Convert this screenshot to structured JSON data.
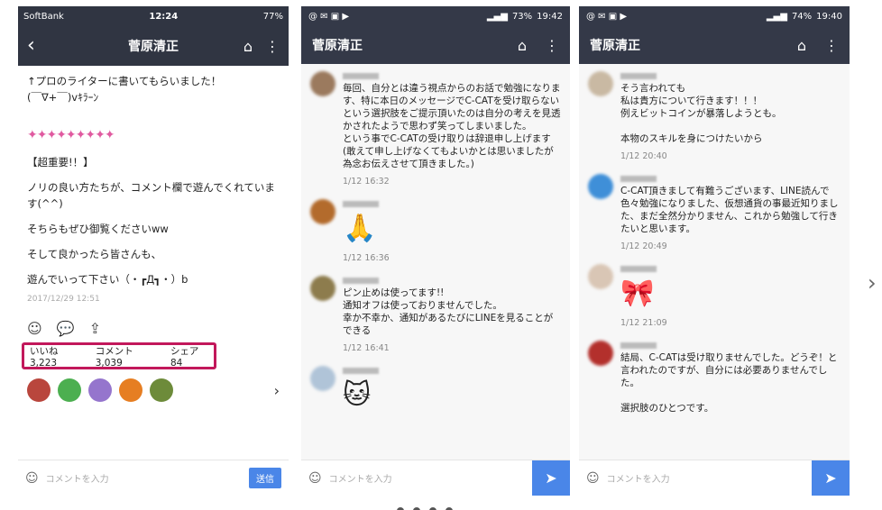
{
  "phone1": {
    "status": {
      "carrier": "SoftBank",
      "time": "12:24",
      "battery": "77%"
    },
    "title": "菅原清正",
    "post": {
      "lines": [
        "↑プロのライターに書いてもらいました！",
        "(￣∇+￣)vｷﾗｰﾝ",
        "【超重要!！】",
        "ノリの良い方たちが、コメント欄で遊んでくれています(^^)",
        "そちらもぜひ御覧くださいww",
        "そして良かったら皆さんも、",
        "遊んでいって下さい（・┏Д┓・）b"
      ],
      "sparkles": "✦✦✦✦✦✦✦✦✦",
      "date": "2017/12/29 12:51"
    },
    "stats": {
      "likes": "いいね 3,223",
      "comments": "コメント 3,039",
      "shares": "シェア 84"
    },
    "input_placeholder": "コメントを入力",
    "send_label": "送信"
  },
  "phone2": {
    "status": {
      "time": "19:42",
      "battery": "73%"
    },
    "title": "菅原清正",
    "comments": [
      {
        "text": "毎回、自分とは違う視点からのお話で勉強になります、特に本日のメッセージでC-CATを受け取らないという選択肢をご提示頂いたのは自分の考えを見透かされたようで思わず笑ってしまいました。\nという事でC-CATの受け取りは辞退申し上げます(敢えて申し上げなくてもよいかとは思いましたが為念お伝えさせて頂きました。)",
        "time": "1/12 16:32"
      },
      {
        "text": "",
        "time": "1/12 16:36"
      },
      {
        "text": "ピン止めは使ってます!!\n通知オフは使っておりませんでした。\n幸か不幸か、通知があるたびにLINEを見ることができる",
        "time": "1/12 16:41"
      },
      {
        "text": "",
        "time": ""
      }
    ],
    "input_placeholder": "コメントを入力"
  },
  "phone3": {
    "status": {
      "time": "19:40",
      "battery": "74%"
    },
    "title": "菅原清正",
    "comments": [
      {
        "text": "そう言われても\n私は貴方について行きます！！！\n例えビットコインが暴落しようとも。\n\n本物のスキルを身につけたいから",
        "time": "1/12 20:40"
      },
      {
        "text": "C-CAT頂きまして有難うございます、LINE読んで色々勉強になりました、仮想通貨の事最近知りました、まだ全然分かりません、これから勉強して行きたいと思います。",
        "time": "1/12 20:49"
      },
      {
        "text": "",
        "time": "1/12 21:09"
      },
      {
        "text": "結局、C-CATは受け取りませんでした。どうぞ！と言われたのですが、自分には必要ありませんでした。\n\n選択肢のひとつです。",
        "time": ""
      }
    ],
    "input_placeholder": "コメントを入力"
  },
  "colors": {
    "header": "#343948",
    "accent": "#4a86e8",
    "highlight": "#c2185b"
  },
  "icons": [
    "back-icon",
    "home-icon",
    "more-icon",
    "smile-icon",
    "comment-icon",
    "share-icon",
    "send-icon",
    "chevron-right-icon"
  ]
}
